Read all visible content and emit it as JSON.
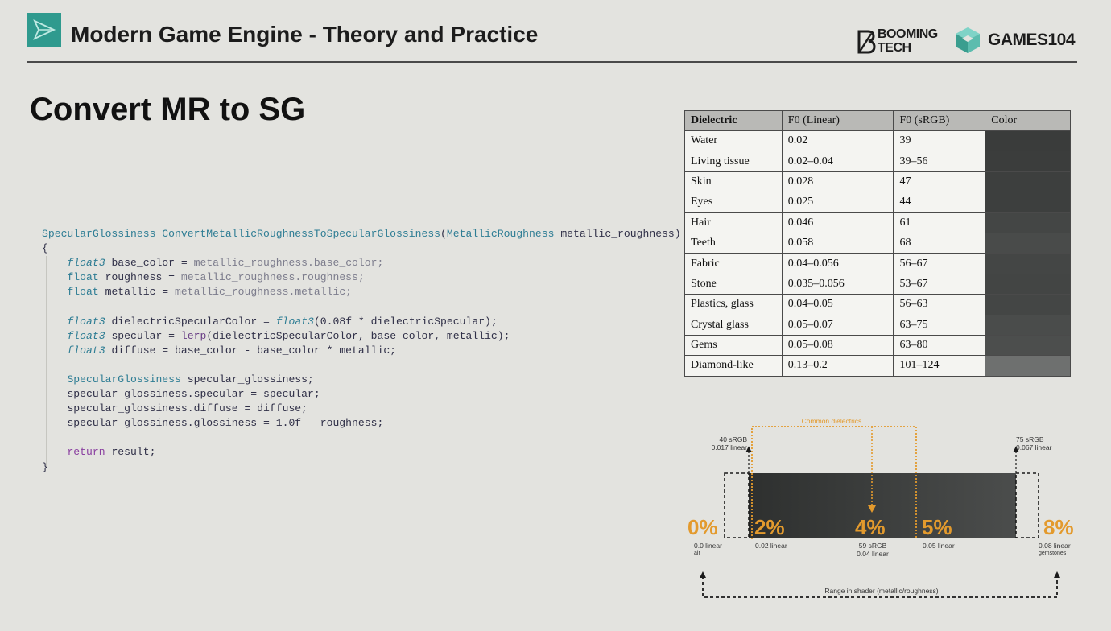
{
  "header": {
    "title": "Modern Game Engine - Theory and Practice",
    "booming_logo_line1": "BOOMING",
    "booming_logo_line2": "TECH",
    "games_logo_text": "GAMES104"
  },
  "slide": {
    "title": "Convert MR to SG"
  },
  "code": {
    "signature_ret": "SpecularGlossiness",
    "signature_fn": "ConvertMetallicRoughnessToSpecularGlossiness",
    "signature_paren_open": "(",
    "signature_param_type": "MetallicRoughness",
    "signature_param_name": "metallic_roughness",
    "signature_paren_close": ")",
    "brace_open": "{",
    "brace_close": "}",
    "l1_type": "float3",
    "l1_name": " base_color = ",
    "l1_val": "metallic_roughness.base_color;",
    "l2_type": "float",
    "l2_name": " roughness = ",
    "l2_val": "metallic_roughness.roughness;",
    "l3_type": "float",
    "l3_name": " metallic = ",
    "l3_val": "metallic_roughness.metallic;",
    "l4_type": "float3",
    "l4_name": " dielectricSpecularColor = ",
    "l4_call": "float3",
    "l4_args": "(0.08f * dielectricSpecular);",
    "l5_type": "float3",
    "l5_name": " specular = ",
    "l5_call": "lerp",
    "l5_args": "(dielectricSpecularColor, base_color, metallic);",
    "l6_type": "float3",
    "l6_rest": " diffuse = base_color - base_color * metallic;",
    "l7_type": "SpecularGlossiness",
    "l7_rest": " specular_glossiness;",
    "l8": "specular_glossiness.specular = specular;",
    "l9": "specular_glossiness.diffuse = diffuse;",
    "l10": "specular_glossiness.glossiness = 1.0f - roughness;",
    "l11_kw": "return",
    "l11_rest": " result;"
  },
  "table": {
    "headers": [
      "Dielectric",
      "F0 (Linear)",
      "F0 (sRGB)",
      "Color"
    ],
    "rows": [
      {
        "name": "Water",
        "linear": "0.02",
        "srgb": "39",
        "color": "#3a3c3b"
      },
      {
        "name": "Living tissue",
        "linear": "0.02–0.04",
        "srgb": "39–56",
        "color": "#3b3d3c"
      },
      {
        "name": "Skin",
        "linear": "0.028",
        "srgb": "47",
        "color": "#3d3f3e"
      },
      {
        "name": "Eyes",
        "linear": "0.025",
        "srgb": "44",
        "color": "#3d3f3e"
      },
      {
        "name": "Hair",
        "linear": "0.046",
        "srgb": "61",
        "color": "#444645"
      },
      {
        "name": "Teeth",
        "linear": "0.058",
        "srgb": "68",
        "color": "#494b4a"
      },
      {
        "name": "Fabric",
        "linear": "0.04–0.056",
        "srgb": "56–67",
        "color": "#444645"
      },
      {
        "name": "Stone",
        "linear": "0.035–0.056",
        "srgb": "53–67",
        "color": "#434544"
      },
      {
        "name": "Plastics, glass",
        "linear": "0.04–0.05",
        "srgb": "56–63",
        "color": "#444645"
      },
      {
        "name": "Crystal glass",
        "linear": "0.05–0.07",
        "srgb": "63–75",
        "color": "#4a4c4b"
      },
      {
        "name": "Gems",
        "linear": "0.05–0.08",
        "srgb": "63–80",
        "color": "#4c4e4d"
      },
      {
        "name": "Diamond-like",
        "linear": "0.13–0.2",
        "srgb": "101–124",
        "color": "#6e706f"
      }
    ]
  },
  "diagram": {
    "common_label": "Common dielectrics",
    "left_top": "40 sRGB",
    "left_top2": "0.017 linear",
    "right_top": "75 sRGB",
    "right_top2": "0.067 linear",
    "pct0": "0%",
    "pct2": "2%",
    "pct4": "4%",
    "pct5": "5%",
    "pct8": "8%",
    "cap0a": "0.0 linear",
    "cap0b": "air",
    "cap2": "0.02 linear",
    "cap4a": "59 sRGB",
    "cap4b": "0.04 linear",
    "cap5": "0.05 linear",
    "cap8a": "0.08 linear",
    "cap8b": "gemstones",
    "range_label": "Range in shader (metallic/roughness)",
    "accent_color": "#e39a2d"
  }
}
